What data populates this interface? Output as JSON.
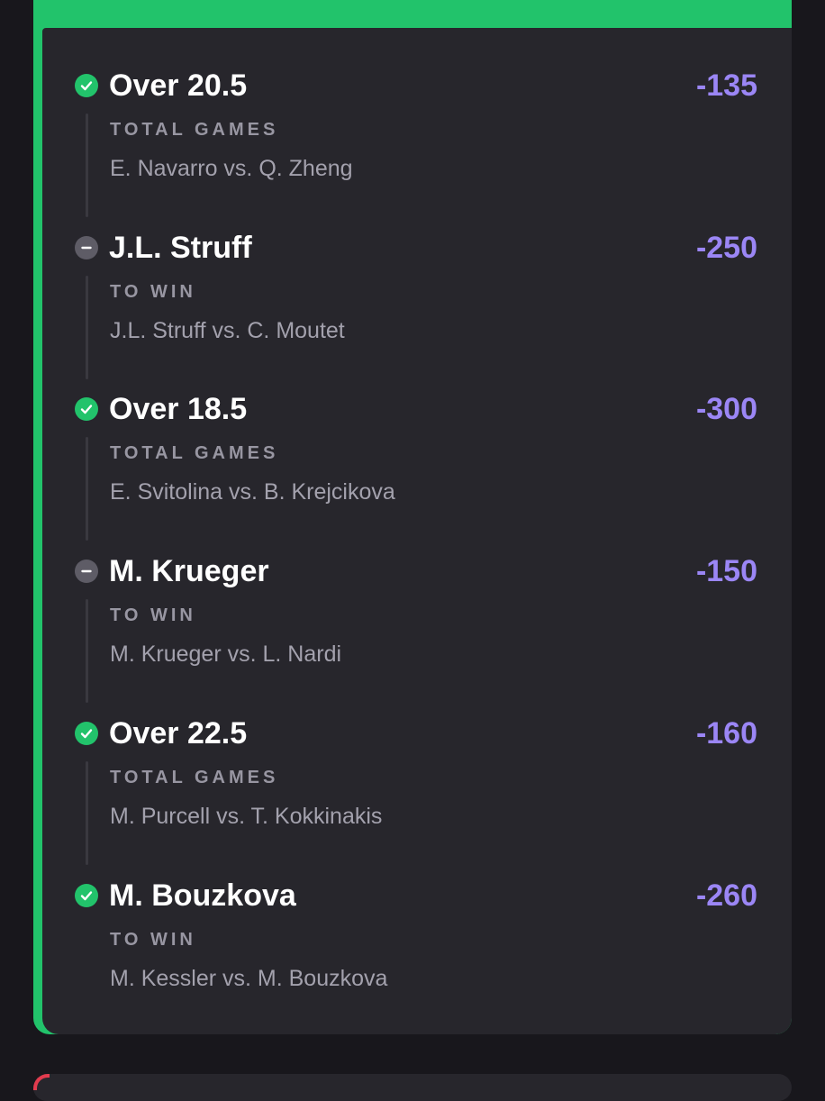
{
  "colors": {
    "win_green": "#22c36b",
    "push_gray": "#5e5c66",
    "odds_purple": "#9b86f5",
    "card_bg": "#27262c",
    "page_bg": "#18171c"
  },
  "legs": [
    {
      "status": "win",
      "status_icon": "check-circle-icon",
      "selection": "Over 20.5",
      "odds": "-135",
      "market": "TOTAL GAMES",
      "matchup": "E. Navarro vs. Q. Zheng"
    },
    {
      "status": "push",
      "status_icon": "minus-circle-icon",
      "selection": "J.L. Struff",
      "odds": "-250",
      "market": "TO WIN",
      "matchup": "J.L. Struff vs. C. Moutet"
    },
    {
      "status": "win",
      "status_icon": "check-circle-icon",
      "selection": "Over 18.5",
      "odds": "-300",
      "market": "TOTAL GAMES",
      "matchup": "E. Svitolina vs. B. Krejcikova"
    },
    {
      "status": "push",
      "status_icon": "minus-circle-icon",
      "selection": "M. Krueger",
      "odds": "-150",
      "market": "TO WIN",
      "matchup": "M. Krueger vs. L. Nardi"
    },
    {
      "status": "win",
      "status_icon": "check-circle-icon",
      "selection": "Over 22.5",
      "odds": "-160",
      "market": "TOTAL GAMES",
      "matchup": "M. Purcell vs. T. Kokkinakis"
    },
    {
      "status": "win",
      "status_icon": "check-circle-icon",
      "selection": "M. Bouzkova",
      "odds": "-260",
      "market": "TO WIN",
      "matchup": "M. Kessler vs. M. Bouzkova"
    }
  ]
}
